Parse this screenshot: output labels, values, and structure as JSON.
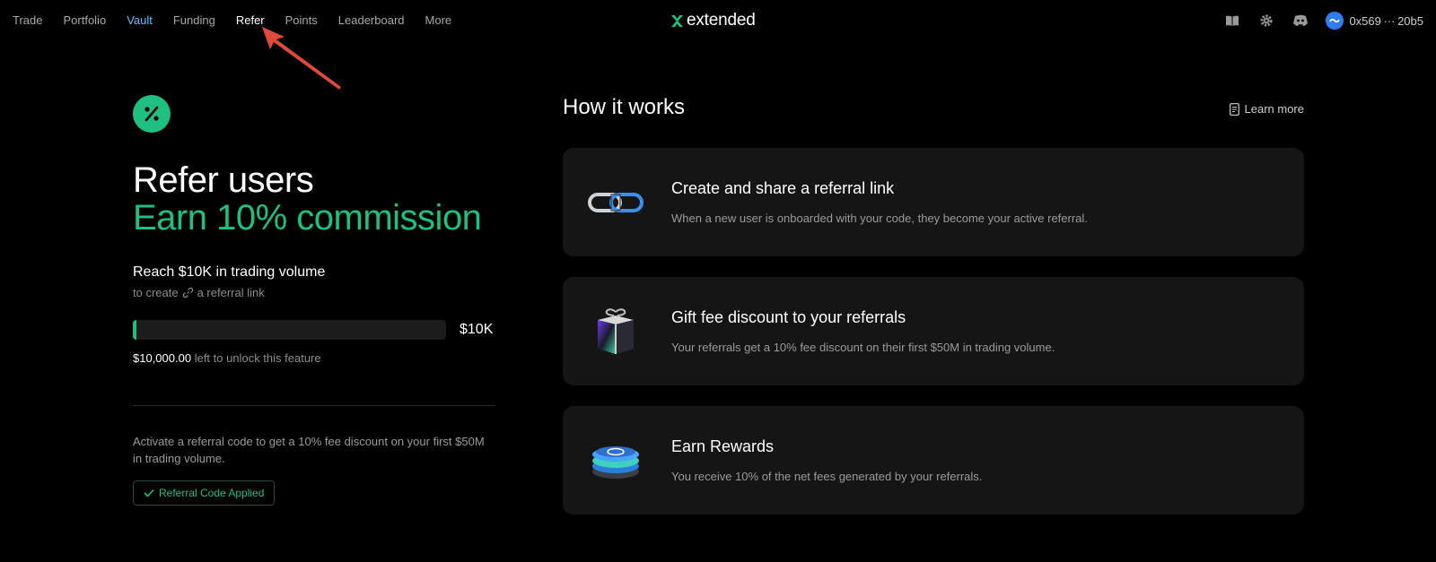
{
  "nav": {
    "items": [
      {
        "label": "Trade"
      },
      {
        "label": "Portfolio"
      },
      {
        "label": "Vault"
      },
      {
        "label": "Funding"
      },
      {
        "label": "Refer"
      },
      {
        "label": "Points"
      },
      {
        "label": "Leaderboard"
      },
      {
        "label": "More"
      }
    ],
    "active": "Refer"
  },
  "brand": {
    "name": "extended",
    "accent": "#1fbf7f"
  },
  "header_right": {
    "icons": [
      "book-icon",
      "gear-icon",
      "discord-icon"
    ],
    "wallet": "0x569 ··· 20b5"
  },
  "refer": {
    "headline_line1": "Refer users",
    "headline_line2": "Earn 10% commission",
    "reach_title": "Reach $10K in trading volume",
    "sub_prefix": "to create",
    "sub_suffix": "a referral link",
    "progress_fraction": 0.012,
    "progress_target": "$10K",
    "remaining_amount": "$10,000.00",
    "remaining_text": "left to unlock this feature",
    "activate_text": "Activate a referral code to get a 10% fee discount on your first $50M in trading volume.",
    "applied_label": "Referral Code Applied"
  },
  "how": {
    "title": "How it works",
    "learn_more": "Learn more",
    "cards": [
      {
        "icon": "chain-link-icon",
        "title": "Create and share a referral link",
        "desc": "When a new user is onboarded with your code, they become your active referral."
      },
      {
        "icon": "gift-box-icon",
        "title": "Gift fee discount to your referrals",
        "desc": "Your referrals get a 10% fee discount on their first $50M in trading volume."
      },
      {
        "icon": "coin-stack-icon",
        "title": "Earn Rewards",
        "desc": "You receive 10% of the net fees generated by your referrals."
      }
    ]
  }
}
